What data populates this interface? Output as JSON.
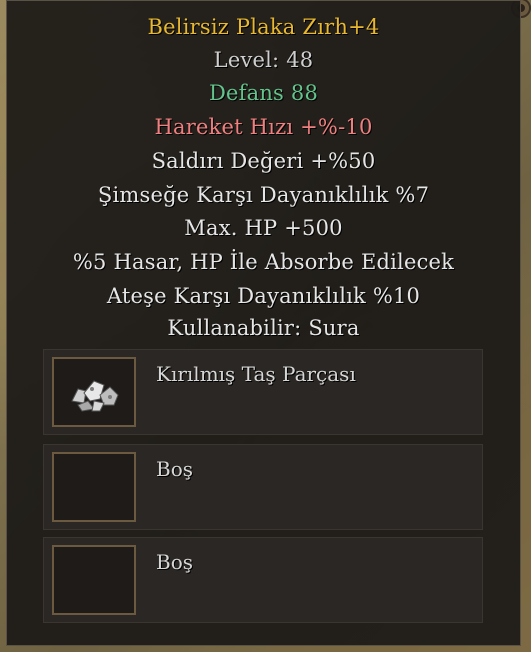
{
  "tooltip": {
    "title": "Belirsiz Plaka Zırh+4",
    "level": "Level: 48",
    "defense": "Defans 88",
    "move_speed": "Hareket Hızı +%-10",
    "attack_value": "Saldırı Değeri +%50",
    "lightning_resist": "Şimseğe Karşı Dayanıklılık %7",
    "max_hp": "Max. HP +500",
    "absorb": "%5 Hasar, HP İle Absorbe Edilecek",
    "fire_resist": "Ateşe Karşı Dayanıklılık %10",
    "usable_by": "Kullanabilir:  Sura"
  },
  "slots": [
    {
      "label": "Kırılmış Taş Parçası",
      "icon": "broken-stone-icon"
    },
    {
      "label": "Boş",
      "icon": ""
    },
    {
      "label": "Boş",
      "icon": ""
    }
  ],
  "colors": {
    "title": "#e8b830",
    "defense": "#63c48c",
    "penalty": "#f08080",
    "bonus": "#e6e6e6"
  }
}
